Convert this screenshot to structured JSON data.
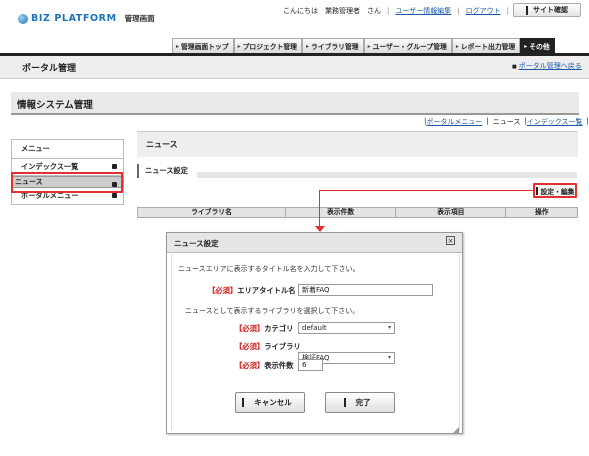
{
  "header": {
    "brand": "BIZ PLATFORM",
    "subtitle": "管理画面",
    "greeting": "こんにちは　業務管理者　さん",
    "user_edit_link": "ユーザー情報編集",
    "logout_link": "ログアウト",
    "site_confirm_button": "サイト確認"
  },
  "nav": {
    "tabs": [
      {
        "label": "管理画面トップ"
      },
      {
        "label": "プロジェクト管理"
      },
      {
        "label": "ライブラリ管理"
      },
      {
        "label": "ユーザー・グループ管理"
      },
      {
        "label": "レポート出力管理"
      },
      {
        "label": "その他"
      }
    ]
  },
  "portal": {
    "title": "ポータル管理",
    "back_link": "ポータル管理へ戻る"
  },
  "system": {
    "title": "情報システム管理"
  },
  "breadcrumb": {
    "items": [
      "ポータルメニュー",
      "ニュース",
      "インデックス一覧"
    ]
  },
  "sidebar": {
    "header": "メニュー",
    "items": [
      {
        "label": "インデックス一覧"
      },
      {
        "label": "ニュース"
      },
      {
        "label": "ポータルメニュー"
      }
    ]
  },
  "main": {
    "title": "ニュース",
    "section": "ニュース設定",
    "settings_button": "設定・編集",
    "table_headers": [
      "ライブラリ名",
      "表示件数",
      "表示項目",
      "操作"
    ]
  },
  "dialog": {
    "title": "ニュース設定",
    "close_icon": "close-icon",
    "instruction1": "ニュースエリアに表示するタイトル名を入力して下さい。",
    "required": "【必須】",
    "area_title_label": "エリアタイトル名",
    "area_title_value": "新着FAQ",
    "instruction2": "ニュースとして表示するライブラリを選択して下さい。",
    "category_label": "カテゴリ",
    "category_value": "default",
    "library_label": "ライブラリ",
    "library_value": "検証FAQ",
    "count_label": "表示件数",
    "count_value": "6",
    "cancel_button": "キャンセル",
    "ok_button": "完了"
  },
  "colors": {
    "accent_red": "#e03030",
    "link_blue": "#1a5aa8",
    "brand_blue": "#1e73b8"
  }
}
